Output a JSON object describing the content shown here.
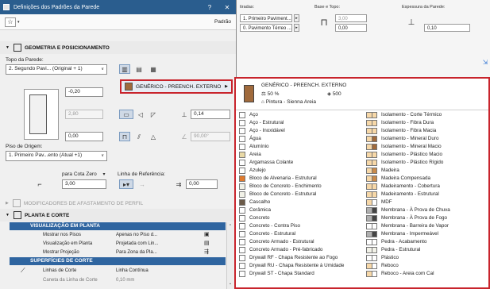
{
  "background": {
    "col1_label": "tiradas:",
    "col1_values": [
      "1. Primeiro Paviment...",
      "0. Pavimento Térreo ..."
    ],
    "col2_label": "Base e Topo:",
    "col2_values": [
      "3,00",
      "0,00"
    ],
    "col3_label": "Espessura da Parede:",
    "col3_value": "0,10"
  },
  "dialog": {
    "title": "Definições dos Padrões da Parede",
    "help_label": "?",
    "close_label": "✕",
    "favorites_star": "☆",
    "favorites_dropdown": "▾",
    "standard_label": "Padrão"
  },
  "geometry": {
    "section_title": "GEOMETRIA E POSICIONAMENTO",
    "top_label": "Topo da Parede:",
    "top_value": "2. Segundo Pavi... (Original + 1)",
    "offset_top": "-0,20",
    "height_value": "2,80",
    "base_offset": "0,00",
    "origin_label": "Piso de Origem:",
    "origin_value": "1. Primeiro Pav...ento (Atual +1)",
    "ref_level_label": "para Cota Zero",
    "ref_level_value": "3,00",
    "ref_line_label": "Linha de Referência:",
    "thickness_value": "0,14",
    "slant_value": "90,00°",
    "ref_offset_value": "0,00"
  },
  "surface_button": {
    "label": "GENÉRICO - PREENCH. EXTERNO"
  },
  "modifiers": {
    "section_title": "MODIFICADORES DE AFASTAMENTO DE PERFIL"
  },
  "plan_section": {
    "section_title": "PLANTA E CORTE",
    "subhead1": "VISUALIZAÇÃO EM PLANTA",
    "rows1": [
      {
        "k": "Mostrar nos Pisos",
        "v": "Apenas no Piso d..."
      },
      {
        "k": "Visualização em Planta",
        "v": "Projetada com Lin..."
      },
      {
        "k": "Mostrar Projeção",
        "v": "Para Zona da Pla..."
      }
    ],
    "subhead2": "SUPERFÍCIES DE CORTE",
    "rows2": [
      {
        "k": "Linhas de Corte",
        "v": "Linha Contínua"
      },
      {
        "k": "Caneta da Linha de Corte",
        "v": "0,10 mm"
      }
    ]
  },
  "popup": {
    "name": "GENÉRICO - PREENCH. EXTERNO",
    "percent": "50 %",
    "pattern": "Pintura - Sienna Areia",
    "count": "500",
    "left_items": [
      {
        "label": "Aço",
        "color": "#ffffff"
      },
      {
        "label": "Aço - Estrutural",
        "color": "#ffffff"
      },
      {
        "label": "Aço - Inoxidável",
        "color": "#ffffff"
      },
      {
        "label": "Água",
        "color": "#ffffff"
      },
      {
        "label": "Alumínio",
        "color": "#ffffff"
      },
      {
        "label": "Areia",
        "color": "#e9d9a6"
      },
      {
        "label": "Argamassa Colante",
        "color": "#ffffff"
      },
      {
        "label": "Azulejo",
        "color": "#ffffff"
      },
      {
        "label": "Bloco de Alvenaria - Estrutural",
        "color": "#e07a2c"
      },
      {
        "label": "Bloco de Concreto - Enchimento",
        "color": "#f2f2e8"
      },
      {
        "label": "Bloco de Concreto - Estrutural",
        "color": "#f2f2e8"
      },
      {
        "label": "Cascalho",
        "color": "#6b5a48"
      },
      {
        "label": "Cerâmica",
        "color": "#ffffff"
      },
      {
        "label": "Concreto",
        "color": "#ffffff"
      },
      {
        "label": "Concreto - Contra Piso",
        "color": "#ffffff"
      },
      {
        "label": "Concreto - Estrutural",
        "color": "#ffffff"
      },
      {
        "label": "Concreto Armado - Estrutural",
        "color": "#ffffff"
      },
      {
        "label": "Concreto Armado - Pré-fabricado",
        "color": "#ffffff"
      },
      {
        "label": "Drywall RF - Chapa Resistente ao Fogo",
        "color": "#ffffff"
      },
      {
        "label": "Drywall RU - Chapa Resistente à Umidade",
        "color": "#ffffff"
      },
      {
        "label": "Drywall ST - Chapa Standard",
        "color": "#ffffff"
      }
    ],
    "right_items": [
      {
        "label": "Isolamento - Corte Térmico",
        "c1": "#f7d8a8",
        "c2": "#f7d8a8"
      },
      {
        "label": "Isolamento - Fibra Dura",
        "c1": "#f7d8a8",
        "c2": "#f7d8a8"
      },
      {
        "label": "Isolamento - Fibra Macia",
        "c1": "#f7d8a8",
        "c2": "#f7d8a8"
      },
      {
        "label": "Isolamento - Mineral Duro",
        "c1": "#f7d8a8",
        "c2": "#a06a3c"
      },
      {
        "label": "Isolamento - Mineral Macio",
        "c1": "#f7d8a8",
        "c2": "#a06a3c"
      },
      {
        "label": "Isolamento - Plástico Macio",
        "c1": "#f7d8a8",
        "c2": "#f7d8a8"
      },
      {
        "label": "Isolamento - Plástico Rígido",
        "c1": "#f7d8a8",
        "c2": "#f7d8a8"
      },
      {
        "label": "Madeira",
        "c1": "#f7d8a8",
        "c2": "#c98a4a"
      },
      {
        "label": "Madeira Compensada",
        "c1": "#f7d8a8",
        "c2": "#c98a4a"
      },
      {
        "label": "Madeiramento - Cobertura",
        "c1": "#f7d8a8",
        "c2": "#f7d8a8"
      },
      {
        "label": "Madeiramento - Estrutural",
        "c1": "#f7d8a8",
        "c2": "#f7d8a8"
      },
      {
        "label": "MDF",
        "c1": "#f7d8a8",
        "c2": "#ffffff"
      },
      {
        "label": "Membrana - À Prova de Chuva",
        "c1": "#b0b0b0",
        "c2": "#444444"
      },
      {
        "label": "Membrana - À Prova de Fogo",
        "c1": "#b0b0b0",
        "c2": "#444444"
      },
      {
        "label": "Membrana - Barreira de Vapor",
        "c1": "#ffffff",
        "c2": "#ffffff"
      },
      {
        "label": "Membrana - Impermeável",
        "c1": "#b0b0b0",
        "c2": "#444444"
      },
      {
        "label": "Pedra - Acabamento",
        "c1": "#ffffff",
        "c2": "#ffffff"
      },
      {
        "label": "Pedra - Estrutural",
        "c1": "#f2f2e8",
        "c2": "#f2f2e8"
      },
      {
        "label": "Plástico",
        "c1": "#ffffff",
        "c2": "#ffffff"
      },
      {
        "label": "Reboco",
        "c1": "#f7d8a8",
        "c2": "#ffffff"
      },
      {
        "label": "Reboco - Areia com Cal",
        "c1": "#f7d8a8",
        "c2": "#ffffff"
      }
    ]
  }
}
